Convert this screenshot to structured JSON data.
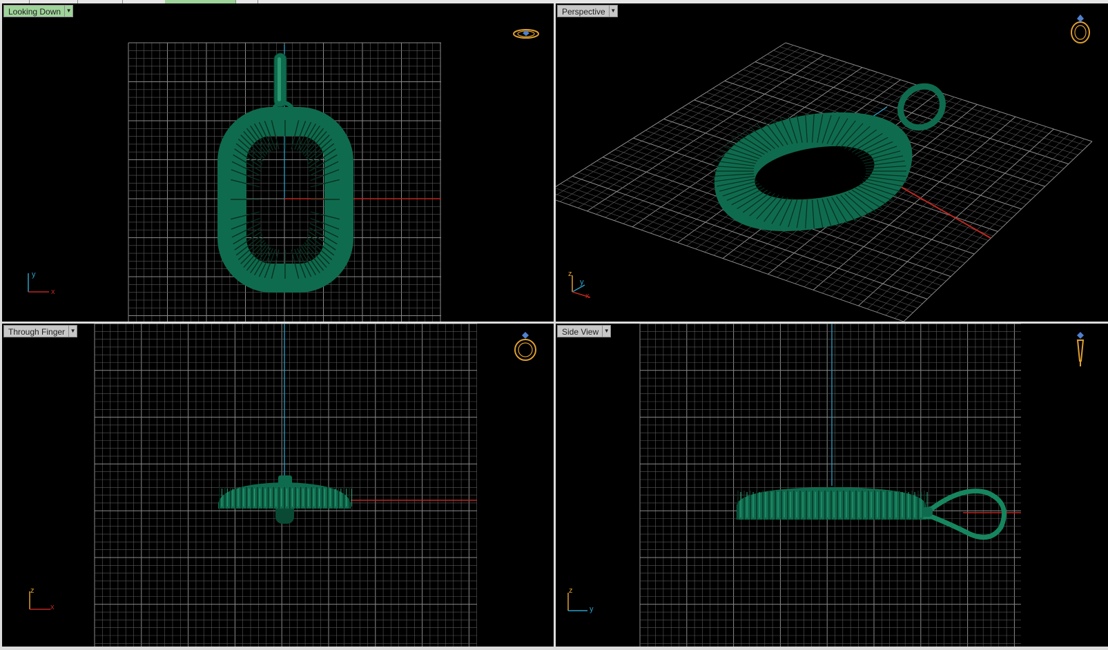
{
  "viewports": [
    {
      "id": "top-left",
      "label": "Looking Down",
      "active": true,
      "axes": {
        "up": "y",
        "right": "x"
      }
    },
    {
      "id": "top-right",
      "label": "Perspective",
      "active": false,
      "axes": {
        "up": "z",
        "mid": "y",
        "right": "x"
      }
    },
    {
      "id": "bottom-left",
      "label": "Through Finger",
      "active": false,
      "axes": {
        "up": "z",
        "right": "x"
      }
    },
    {
      "id": "bottom-right",
      "label": "Side View",
      "active": false,
      "axes": {
        "up": "z",
        "right": "y"
      }
    }
  ],
  "colors": {
    "background": "#000000",
    "grid": "#5a5a5a",
    "grid_major": "#8c8c8c",
    "model": "#0f6b4e",
    "x_axis": "#c0271f",
    "y_axis": "#2aa0c8",
    "z_axis": "#2aa0c8",
    "active_label": "#9fd49a"
  },
  "icons": {
    "dropdown": "chevron-down-icon",
    "view_gizmo": "ring-gizmo-icon"
  }
}
